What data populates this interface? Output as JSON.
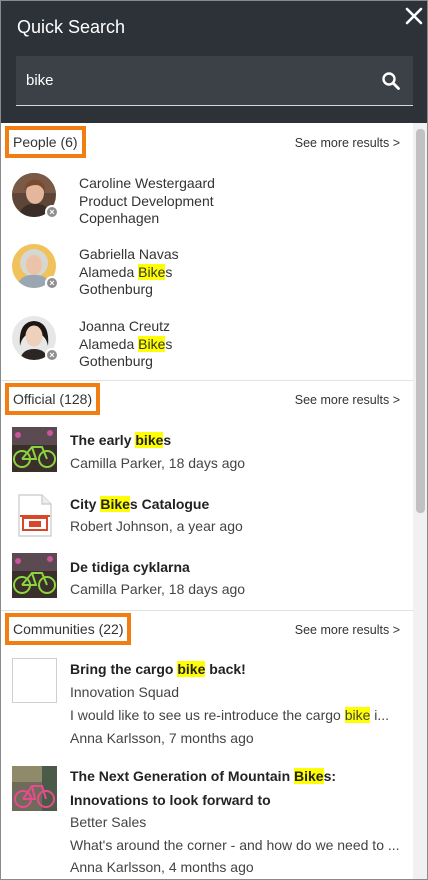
{
  "header": {
    "title": "Quick Search",
    "close_glyph": "✕"
  },
  "search": {
    "value": "bike"
  },
  "people": {
    "label": "People (6)",
    "see_more": "See more results >",
    "items": [
      {
        "name": "Caroline Westergaard",
        "role_pre": "Product Development",
        "role_hl": "",
        "role_post": "",
        "location": "Copenhagen"
      },
      {
        "name": "Gabriella Navas",
        "role_pre": "Alameda ",
        "role_hl": "Bike",
        "role_post": "s",
        "location": "Gothenburg"
      },
      {
        "name": "Joanna Creutz",
        "role_pre": "Alameda ",
        "role_hl": "Bike",
        "role_post": "s",
        "location": "Gothenburg"
      }
    ]
  },
  "official": {
    "label": "Official (128)",
    "see_more": "See more results >",
    "items": [
      {
        "title_pre": "The early ",
        "title_hl": "bike",
        "title_post": "s",
        "meta": "Camilla Parker, 18 days ago"
      },
      {
        "title_pre": "City ",
        "title_hl": "Bike",
        "title_post": "s Catalogue",
        "meta": "Robert Johnson, a year ago"
      },
      {
        "title_pre": "De tidiga cyklarna",
        "title_hl": "",
        "title_post": "",
        "meta": "Camilla Parker, 18 days ago"
      }
    ]
  },
  "communities": {
    "label": "Communities (22)",
    "see_more": "See more results >",
    "items": [
      {
        "title_pre": "Bring the cargo ",
        "title_hl": "bike",
        "title_post": " back!",
        "community": "Innovation Squad",
        "desc_pre": "I would like to see us re-introduce the cargo ",
        "desc_hl": "bike",
        "desc_post": " i...",
        "meta": "Anna Karlsson, 7 months ago"
      },
      {
        "title_pre": "The Next Generation of Mountain ",
        "title_hl": "Bike",
        "title_post": "s:",
        "title_line2": "Innovations to look forward to",
        "community": "Better Sales",
        "desc_pre": "What's around the corner - and how do we need to ...",
        "desc_hl": "",
        "desc_post": "",
        "meta": "Anna Karlsson, 4 months ago"
      }
    ]
  },
  "colors": {
    "header_bg": "#2c3237",
    "search_bg": "#3b4147",
    "accent_outline": "#f27d12",
    "highlight": "#ffff00"
  }
}
